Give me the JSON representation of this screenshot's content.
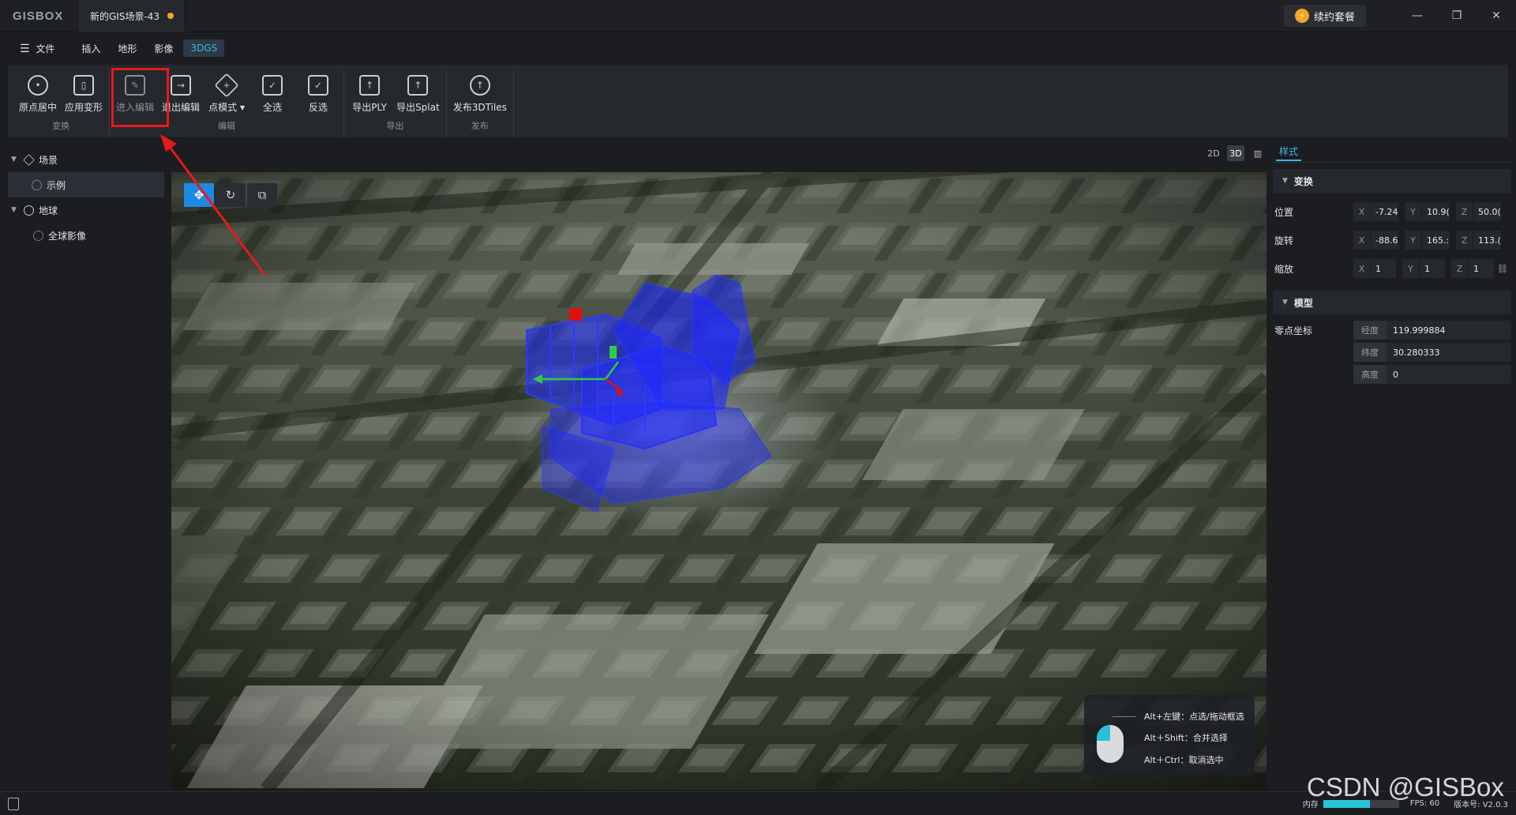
{
  "app": {
    "logo": "GISBOX",
    "doc_tab": "新的GIS场景-43",
    "renew_label": "续约套餐",
    "window_controls": {
      "minimize": "—",
      "restore": "❐",
      "close": "✕"
    }
  },
  "menu": {
    "file": "文件",
    "items": [
      "插入",
      "地形",
      "影像",
      "3DGS"
    ],
    "active": "3DGS"
  },
  "ribbon": {
    "groups": [
      {
        "label": "变换",
        "buttons": [
          {
            "label": "原点居中",
            "icon": "target-icon"
          },
          {
            "label": "应用变形",
            "icon": "map-icon"
          }
        ]
      },
      {
        "label": "编辑",
        "buttons": [
          {
            "label": "进入编辑",
            "icon": "edit-icon"
          },
          {
            "label": "退出编辑",
            "icon": "exit-edit-icon"
          },
          {
            "label": "点模式 ▾",
            "icon": "point-mode-icon"
          },
          {
            "label": "全选",
            "icon": "select-all-icon"
          },
          {
            "label": "反选",
            "icon": "invert-select-icon"
          }
        ]
      },
      {
        "label": "导出",
        "buttons": [
          {
            "label": "导出PLY",
            "icon": "export-icon"
          },
          {
            "label": "导出Splat",
            "icon": "export-icon"
          }
        ]
      },
      {
        "label": "发布",
        "buttons": [
          {
            "label": "发布3DTiles",
            "icon": "cloud-upload-icon"
          }
        ]
      }
    ]
  },
  "tree": {
    "items": [
      {
        "label": "场景",
        "level": 0,
        "icon": "cube-icon"
      },
      {
        "label": "示例",
        "level": 1,
        "icon": "points-icon",
        "selected": true
      },
      {
        "label": "地球",
        "level": 0,
        "icon": "globe-icon"
      },
      {
        "label": "全球影像",
        "level": 1,
        "icon": "points-icon"
      }
    ]
  },
  "view_modes": [
    "2D",
    "3D",
    "▥"
  ],
  "view_mode_active": "3D",
  "viewport_tools": [
    "✥",
    "↻",
    "⧉"
  ],
  "hints": [
    "Alt+左键：点选/拖动框选",
    "Alt＋Shift：合并选择",
    "Alt＋Ctrl：取消选中"
  ],
  "panel": {
    "tab": "样式",
    "transform_title": "变换",
    "rows": [
      {
        "label": "位置",
        "x": "-7.24",
        "y": "10.9(",
        "z": "50.0("
      },
      {
        "label": "旋转",
        "x": "-88.6",
        "y": "165.:",
        "z": "113.("
      },
      {
        "label": "缩放",
        "x": "1",
        "y": "1",
        "z": "1"
      }
    ],
    "axis_x": "X",
    "axis_y": "Y",
    "axis_z": "Z",
    "link_icon": "⛓",
    "model_title": "模型",
    "origin_label": "零点坐标",
    "origin": [
      {
        "key": "经度",
        "value": "119.999884"
      },
      {
        "key": "纬度",
        "value": "30.280333"
      },
      {
        "key": "高度",
        "value": "0"
      }
    ]
  },
  "status": {
    "memory_label": "内存",
    "memory_fill": 0.62,
    "fps": "FPS: 60",
    "version": "版本号: V2.0.3",
    "accent": "#29c1d6"
  },
  "watermark": "CSDN @GISBox"
}
